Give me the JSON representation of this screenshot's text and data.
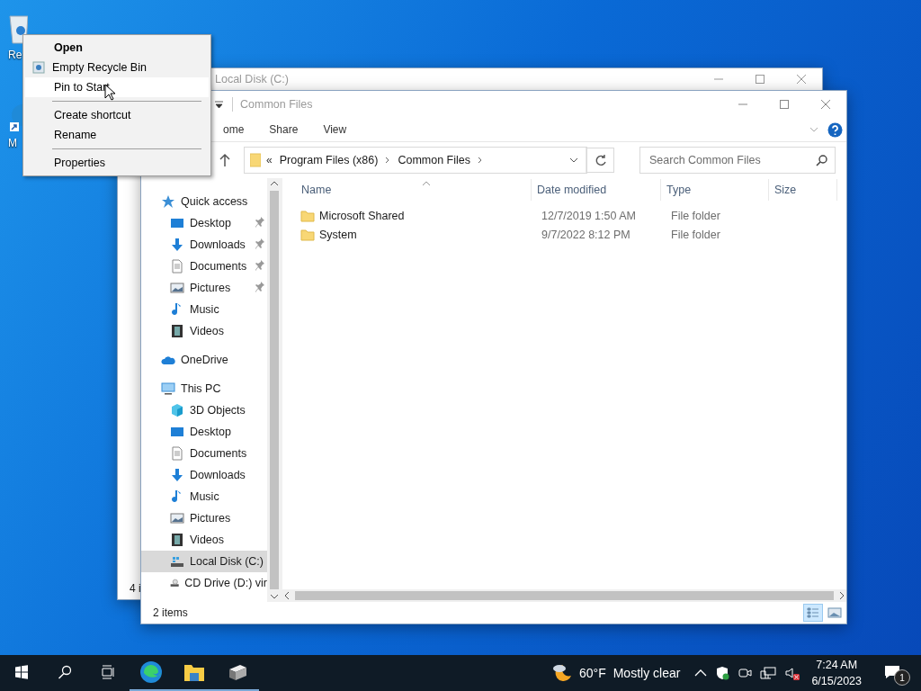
{
  "desktop_icons": [
    {
      "label": "Re",
      "kind": "bin"
    },
    {
      "label": "M",
      "kind": "shortcut"
    }
  ],
  "context_menu": {
    "items": [
      {
        "kind": "item",
        "label": "Open",
        "default": true,
        "has_icon": false,
        "selected": false
      },
      {
        "kind": "item",
        "label": "Empty Recycle Bin",
        "default": false,
        "has_icon": true,
        "selected": false
      },
      {
        "kind": "item",
        "label": "Pin to Start",
        "default": false,
        "has_icon": false,
        "selected": true
      },
      {
        "kind": "separator"
      },
      {
        "kind": "item",
        "label": "Create shortcut",
        "default": false,
        "has_icon": false,
        "selected": false
      },
      {
        "kind": "item",
        "label": "Rename",
        "default": false,
        "has_icon": false,
        "selected": false
      },
      {
        "kind": "separator"
      },
      {
        "kind": "item",
        "label": "Properties",
        "default": false,
        "has_icon": false,
        "selected": false
      }
    ]
  },
  "back_window": {
    "title": "Local Disk (C:)",
    "status": "4 i"
  },
  "window": {
    "title": "Common Files",
    "ribbon_tabs": [
      {
        "label": "ome",
        "selected": false
      },
      {
        "label": "Share",
        "selected": false
      },
      {
        "label": "View",
        "selected": false
      }
    ],
    "address": {
      "overflow": "«",
      "segments": [
        "Program Files (x86)",
        "Common Files"
      ]
    },
    "search": {
      "placeholder": "Search Common Files"
    },
    "navigation": [
      {
        "label": "Quick access",
        "kind": "star",
        "pinned": false,
        "selected": false,
        "children": [
          {
            "label": "Desktop",
            "kind": "desktop",
            "pinned": true,
            "selected": false
          },
          {
            "label": "Downloads",
            "kind": "downloads",
            "pinned": true,
            "selected": false
          },
          {
            "label": "Documents",
            "kind": "documents",
            "pinned": true,
            "selected": false
          },
          {
            "label": "Pictures",
            "kind": "pictures",
            "pinned": true,
            "selected": false
          },
          {
            "label": "Music",
            "kind": "music",
            "pinned": false,
            "selected": false
          },
          {
            "label": "Videos",
            "kind": "videos",
            "pinned": false,
            "selected": false
          }
        ]
      },
      {
        "label": "OneDrive",
        "kind": "cloud",
        "pinned": false,
        "selected": false
      },
      {
        "label": "This PC",
        "kind": "pc",
        "pinned": false,
        "selected": false,
        "children": [
          {
            "label": "3D Objects",
            "kind": "objects",
            "pinned": false,
            "selected": false
          },
          {
            "label": "Desktop",
            "kind": "desktop",
            "pinned": false,
            "selected": false
          },
          {
            "label": "Documents",
            "kind": "documents",
            "pinned": false,
            "selected": false
          },
          {
            "label": "Downloads",
            "kind": "downloads",
            "pinned": false,
            "selected": false
          },
          {
            "label": "Music",
            "kind": "music",
            "pinned": false,
            "selected": false
          },
          {
            "label": "Pictures",
            "kind": "pictures",
            "pinned": false,
            "selected": false
          },
          {
            "label": "Videos",
            "kind": "videos",
            "pinned": false,
            "selected": false
          },
          {
            "label": "Local Disk (C:)",
            "kind": "disk",
            "pinned": false,
            "selected": true
          },
          {
            "label": "CD Drive (D:) vir",
            "kind": "cd",
            "pinned": false,
            "selected": false
          }
        ]
      }
    ],
    "columns": [
      "Name",
      "Date modified",
      "Type",
      "Size"
    ],
    "rows": [
      {
        "name": "Microsoft Shared",
        "date": "12/7/2019 1:50 AM",
        "type": "File folder"
      },
      {
        "name": "System",
        "date": "9/7/2022 8:12 PM",
        "type": "File folder"
      }
    ],
    "status": "2 items",
    "views": [
      {
        "kind": "details",
        "selected": true
      },
      {
        "kind": "large",
        "selected": false
      }
    ]
  },
  "taskbar": {
    "apps": [
      {
        "kind": "browser",
        "running": true
      },
      {
        "kind": "explorer",
        "running": true
      },
      {
        "kind": "device",
        "running": true
      }
    ],
    "temperature": "60°F",
    "weather": "Mostly clear",
    "volume_muted": true,
    "time": "7:24 AM",
    "date": "6/15/2023",
    "notifications": "1"
  }
}
